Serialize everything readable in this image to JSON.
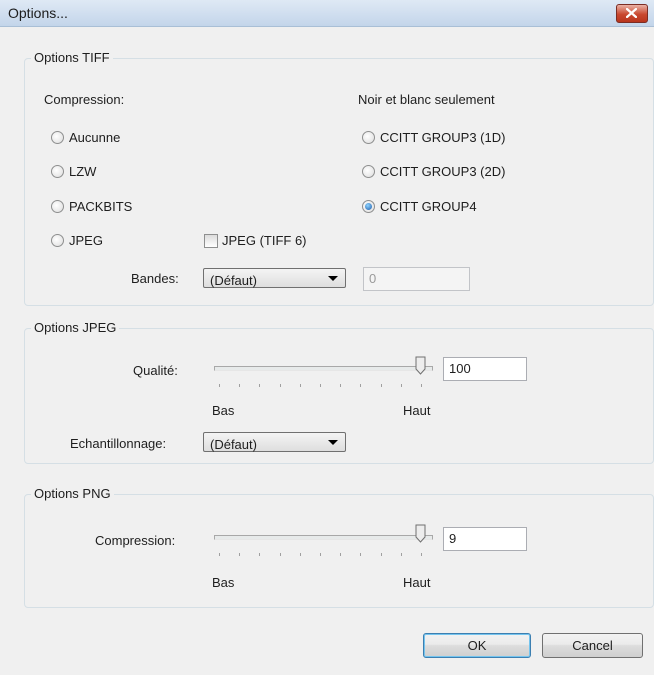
{
  "window": {
    "title": "Options..."
  },
  "tiff": {
    "group_title": "Options TIFF",
    "compression_label": "Compression:",
    "bw_label": "Noir et blanc seulement",
    "compression_options": [
      {
        "label": "Aucunne",
        "checked": false
      },
      {
        "label": "LZW",
        "checked": false
      },
      {
        "label": "PACKBITS",
        "checked": false
      },
      {
        "label": "JPEG",
        "checked": false
      }
    ],
    "bw_options": [
      {
        "label": "CCITT GROUP3 (1D)",
        "checked": false
      },
      {
        "label": "CCITT GROUP3 (2D)",
        "checked": false
      },
      {
        "label": "CCITT GROUP4",
        "checked": true
      }
    ],
    "jpeg_tiff6_label": "JPEG (TIFF 6)",
    "jpeg_tiff6_checked": false,
    "bandes_label": "Bandes:",
    "bandes_value": "(Défaut)",
    "bandes_count": "0"
  },
  "jpeg": {
    "group_title": "Options JPEG",
    "quality_label": "Qualité:",
    "quality_value": "100",
    "quality_level": 100,
    "low_label": "Bas",
    "high_label": "Haut",
    "sampling_label": "Echantillonnage:",
    "sampling_value": "(Défaut)"
  },
  "png": {
    "group_title": "Options PNG",
    "compression_label": "Compression:",
    "compression_value": "9",
    "compression_level": 9,
    "low_label": "Bas",
    "high_label": "Haut"
  },
  "buttons": {
    "ok": "OK",
    "cancel": "Cancel"
  },
  "icons": {
    "close": "close-icon",
    "dropdown": "chevron-down-icon"
  }
}
